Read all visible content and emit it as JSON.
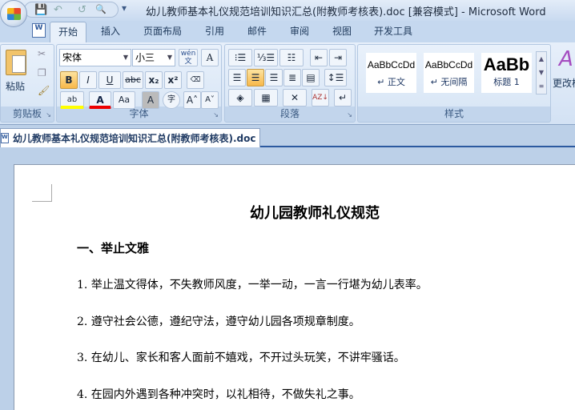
{
  "window": {
    "title": "幼儿教师基本礼仪规范培训知识汇总(附教师考核表).doc [兼容模式] - Microsoft Word"
  },
  "qat": {
    "save": "💾",
    "undo": "↶",
    "redo": "↺",
    "preview": "🔍",
    "customize": "▾"
  },
  "tabs": [
    "开始",
    "插入",
    "页面布局",
    "引用",
    "邮件",
    "审阅",
    "视图",
    "开发工具"
  ],
  "clipboard": {
    "paste": "粘贴",
    "label": "剪贴板"
  },
  "font": {
    "name": "宋体",
    "size": "小三",
    "label": "字体",
    "bold": "B",
    "italic": "I",
    "underline": "U",
    "strike": "abc",
    "sub": "x₂",
    "sup": "x²",
    "highlight": "ab",
    "color": "A",
    "case": "Aa",
    "shade": "A",
    "enclose": "字",
    "grow": "A˄",
    "shrink": "A˅",
    "phonetic": "wén文",
    "border": "A"
  },
  "paragraph": {
    "label": "段落"
  },
  "styles": {
    "label": "样式",
    "items": [
      {
        "preview": "AaBbCcDd",
        "name": "↵ 正文"
      },
      {
        "preview": "AaBbCcDd",
        "name": "↵ 无间隔"
      },
      {
        "preview": "AaBb",
        "name": "标题 1"
      }
    ],
    "change": "更改样式"
  },
  "document": {
    "tab": "幼儿教师基本礼仪规范培训知识汇总(附教师考核表).doc",
    "title": "幼儿园教师礼仪规范",
    "heading": "一、举止文雅",
    "items": [
      "1. 举止温文得体，不失教师风度，一举一动，一言一行堪为幼儿表率。",
      "2. 遵守社会公德，遵纪守法，遵守幼儿园各项规章制度。",
      "3. 在幼儿、家长和客人面前不嬉戏，不开过头玩笑，不讲牢骚话。",
      "4. 在园内外遇到各种冲突时，以礼相待，不做失礼之事。"
    ]
  }
}
